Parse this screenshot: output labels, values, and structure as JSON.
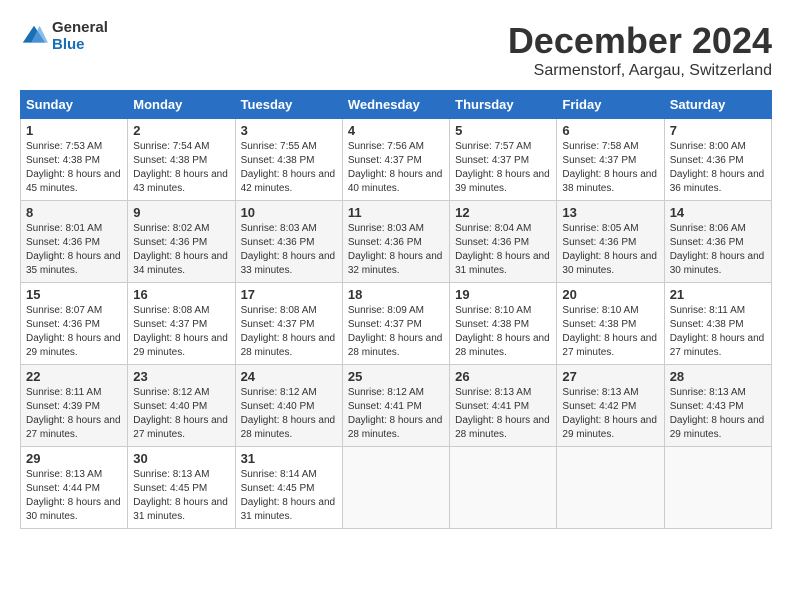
{
  "logo": {
    "general": "General",
    "blue": "Blue"
  },
  "title": "December 2024",
  "location": "Sarmenstorf, Aargau, Switzerland",
  "weekdays": [
    "Sunday",
    "Monday",
    "Tuesday",
    "Wednesday",
    "Thursday",
    "Friday",
    "Saturday"
  ],
  "weeks": [
    [
      {
        "day": "1",
        "sunrise": "Sunrise: 7:53 AM",
        "sunset": "Sunset: 4:38 PM",
        "daylight": "Daylight: 8 hours and 45 minutes."
      },
      {
        "day": "2",
        "sunrise": "Sunrise: 7:54 AM",
        "sunset": "Sunset: 4:38 PM",
        "daylight": "Daylight: 8 hours and 43 minutes."
      },
      {
        "day": "3",
        "sunrise": "Sunrise: 7:55 AM",
        "sunset": "Sunset: 4:38 PM",
        "daylight": "Daylight: 8 hours and 42 minutes."
      },
      {
        "day": "4",
        "sunrise": "Sunrise: 7:56 AM",
        "sunset": "Sunset: 4:37 PM",
        "daylight": "Daylight: 8 hours and 40 minutes."
      },
      {
        "day": "5",
        "sunrise": "Sunrise: 7:57 AM",
        "sunset": "Sunset: 4:37 PM",
        "daylight": "Daylight: 8 hours and 39 minutes."
      },
      {
        "day": "6",
        "sunrise": "Sunrise: 7:58 AM",
        "sunset": "Sunset: 4:37 PM",
        "daylight": "Daylight: 8 hours and 38 minutes."
      },
      {
        "day": "7",
        "sunrise": "Sunrise: 8:00 AM",
        "sunset": "Sunset: 4:36 PM",
        "daylight": "Daylight: 8 hours and 36 minutes."
      }
    ],
    [
      {
        "day": "8",
        "sunrise": "Sunrise: 8:01 AM",
        "sunset": "Sunset: 4:36 PM",
        "daylight": "Daylight: 8 hours and 35 minutes."
      },
      {
        "day": "9",
        "sunrise": "Sunrise: 8:02 AM",
        "sunset": "Sunset: 4:36 PM",
        "daylight": "Daylight: 8 hours and 34 minutes."
      },
      {
        "day": "10",
        "sunrise": "Sunrise: 8:03 AM",
        "sunset": "Sunset: 4:36 PM",
        "daylight": "Daylight: 8 hours and 33 minutes."
      },
      {
        "day": "11",
        "sunrise": "Sunrise: 8:03 AM",
        "sunset": "Sunset: 4:36 PM",
        "daylight": "Daylight: 8 hours and 32 minutes."
      },
      {
        "day": "12",
        "sunrise": "Sunrise: 8:04 AM",
        "sunset": "Sunset: 4:36 PM",
        "daylight": "Daylight: 8 hours and 31 minutes."
      },
      {
        "day": "13",
        "sunrise": "Sunrise: 8:05 AM",
        "sunset": "Sunset: 4:36 PM",
        "daylight": "Daylight: 8 hours and 30 minutes."
      },
      {
        "day": "14",
        "sunrise": "Sunrise: 8:06 AM",
        "sunset": "Sunset: 4:36 PM",
        "daylight": "Daylight: 8 hours and 30 minutes."
      }
    ],
    [
      {
        "day": "15",
        "sunrise": "Sunrise: 8:07 AM",
        "sunset": "Sunset: 4:36 PM",
        "daylight": "Daylight: 8 hours and 29 minutes."
      },
      {
        "day": "16",
        "sunrise": "Sunrise: 8:08 AM",
        "sunset": "Sunset: 4:37 PM",
        "daylight": "Daylight: 8 hours and 29 minutes."
      },
      {
        "day": "17",
        "sunrise": "Sunrise: 8:08 AM",
        "sunset": "Sunset: 4:37 PM",
        "daylight": "Daylight: 8 hours and 28 minutes."
      },
      {
        "day": "18",
        "sunrise": "Sunrise: 8:09 AM",
        "sunset": "Sunset: 4:37 PM",
        "daylight": "Daylight: 8 hours and 28 minutes."
      },
      {
        "day": "19",
        "sunrise": "Sunrise: 8:10 AM",
        "sunset": "Sunset: 4:38 PM",
        "daylight": "Daylight: 8 hours and 28 minutes."
      },
      {
        "day": "20",
        "sunrise": "Sunrise: 8:10 AM",
        "sunset": "Sunset: 4:38 PM",
        "daylight": "Daylight: 8 hours and 27 minutes."
      },
      {
        "day": "21",
        "sunrise": "Sunrise: 8:11 AM",
        "sunset": "Sunset: 4:38 PM",
        "daylight": "Daylight: 8 hours and 27 minutes."
      }
    ],
    [
      {
        "day": "22",
        "sunrise": "Sunrise: 8:11 AM",
        "sunset": "Sunset: 4:39 PM",
        "daylight": "Daylight: 8 hours and 27 minutes."
      },
      {
        "day": "23",
        "sunrise": "Sunrise: 8:12 AM",
        "sunset": "Sunset: 4:40 PM",
        "daylight": "Daylight: 8 hours and 27 minutes."
      },
      {
        "day": "24",
        "sunrise": "Sunrise: 8:12 AM",
        "sunset": "Sunset: 4:40 PM",
        "daylight": "Daylight: 8 hours and 28 minutes."
      },
      {
        "day": "25",
        "sunrise": "Sunrise: 8:12 AM",
        "sunset": "Sunset: 4:41 PM",
        "daylight": "Daylight: 8 hours and 28 minutes."
      },
      {
        "day": "26",
        "sunrise": "Sunrise: 8:13 AM",
        "sunset": "Sunset: 4:41 PM",
        "daylight": "Daylight: 8 hours and 28 minutes."
      },
      {
        "day": "27",
        "sunrise": "Sunrise: 8:13 AM",
        "sunset": "Sunset: 4:42 PM",
        "daylight": "Daylight: 8 hours and 29 minutes."
      },
      {
        "day": "28",
        "sunrise": "Sunrise: 8:13 AM",
        "sunset": "Sunset: 4:43 PM",
        "daylight": "Daylight: 8 hours and 29 minutes."
      }
    ],
    [
      {
        "day": "29",
        "sunrise": "Sunrise: 8:13 AM",
        "sunset": "Sunset: 4:44 PM",
        "daylight": "Daylight: 8 hours and 30 minutes."
      },
      {
        "day": "30",
        "sunrise": "Sunrise: 8:13 AM",
        "sunset": "Sunset: 4:45 PM",
        "daylight": "Daylight: 8 hours and 31 minutes."
      },
      {
        "day": "31",
        "sunrise": "Sunrise: 8:14 AM",
        "sunset": "Sunset: 4:45 PM",
        "daylight": "Daylight: 8 hours and 31 minutes."
      },
      null,
      null,
      null,
      null
    ]
  ]
}
